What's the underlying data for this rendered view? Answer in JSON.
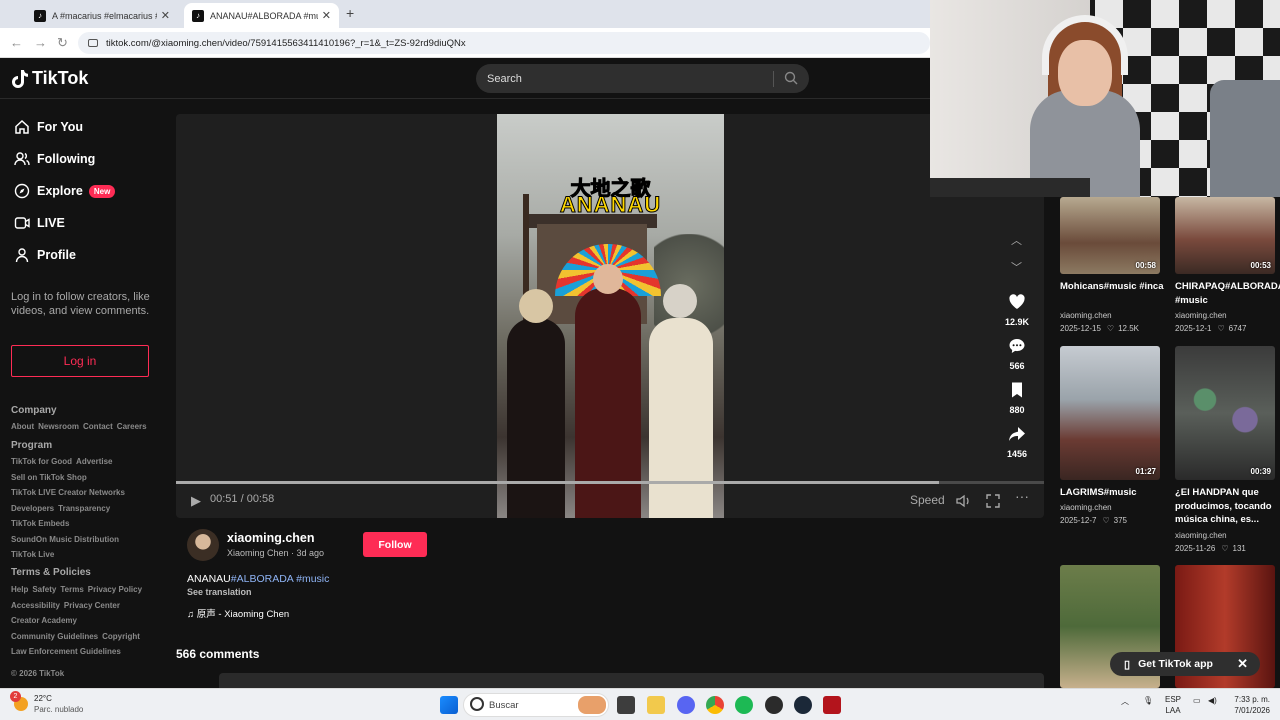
{
  "browser": {
    "tabs": [
      {
        "title": "A #macarius #elmacarius #vide",
        "active": false
      },
      {
        "title": "ANANAU#ALBORADA #music |",
        "active": true
      }
    ],
    "url": "tiktok.com/@xiaoming.chen/video/7591415563411410196?_r=1&_t=ZS-92rd9diuQNx"
  },
  "header": {
    "logo": "TikTok",
    "search_placeholder": "Search"
  },
  "sidebar": {
    "nav": [
      {
        "label": "For You",
        "icon": "home-icon"
      },
      {
        "label": "Following",
        "icon": "users-icon"
      },
      {
        "label": "Explore",
        "icon": "compass-icon",
        "badge": "New"
      },
      {
        "label": "LIVE",
        "icon": "live-icon"
      },
      {
        "label": "Profile",
        "icon": "person-icon"
      }
    ],
    "login_hint": "Log in to follow creators, like videos, and view comments.",
    "login_button": "Log in",
    "company_title": "Company",
    "company_links": [
      "About",
      "Newsroom",
      "Contact",
      "Careers"
    ],
    "program_title": "Program",
    "program_links": [
      "TikTok for Good",
      "Advertise",
      "Sell on TikTok Shop",
      "TikTok LIVE Creator Networks",
      "Developers",
      "Transparency",
      "TikTok Embeds",
      "SoundOn Music Distribution",
      "TikTok Live"
    ],
    "terms_title": "Terms & Policies",
    "terms_links": [
      "Help",
      "Safety",
      "Terms",
      "Privacy Policy",
      "Accessibility",
      "Privacy Center",
      "Creator Academy",
      "Community Guidelines",
      "Copyright",
      "Law Enforcement Guidelines"
    ],
    "copyright": "© 2026 TikTok"
  },
  "video": {
    "caption_cn": "大地之歌",
    "caption_en": "ANANAU",
    "time": "00:51 / 00:58",
    "progress": 0.879,
    "speed_label": "Speed"
  },
  "actions": {
    "likes": "12.9K",
    "comments": "566",
    "saves": "880",
    "shares": "1456"
  },
  "author": {
    "username": "xiaoming.chen",
    "display": "Xiaoming Chen · 3d ago",
    "follow_label": "Follow"
  },
  "description": {
    "text": "ANANAU",
    "tags": "#ALBORADA #music",
    "see_translation": "See translation",
    "music": "♫ 原声 - Xiaoming Chen"
  },
  "comments_title": "566 comments",
  "related": [
    {
      "title": "Mohicans#music #inca",
      "author": "xiaoming.chen",
      "date": "2025-12-15",
      "likes": "12.5K",
      "duration": "00:58"
    },
    {
      "title": "CHIRAPAQ#ALBORADA #music",
      "author": "xiaoming.chen",
      "date": "2025-12-1",
      "likes": "6747",
      "duration": "00:53"
    },
    {
      "title": "LAGRIMS#music",
      "author": "xiaoming.chen",
      "date": "2025-12-7",
      "likes": "375",
      "duration": "01:27"
    },
    {
      "title": "¿El HANDPAN que producimos, tocando música china, es...",
      "author": "xiaoming.chen",
      "date": "2025-11-26",
      "likes": "131",
      "duration": "00:39"
    },
    {
      "title": "",
      "author": "",
      "date": "",
      "likes": "",
      "duration": ""
    },
    {
      "title": "",
      "author": "",
      "date": "",
      "likes": "",
      "duration": ""
    }
  ],
  "get_app": "Get TikTok app",
  "taskbar": {
    "weather_temp": "22°C",
    "weather_desc": "Parc. nublado",
    "weather_badge": "2",
    "search_placeholder": "Buscar",
    "lang1": "ESP",
    "lang2": "LAA",
    "time": "7:33 p. m.",
    "date": "7/01/2026"
  }
}
